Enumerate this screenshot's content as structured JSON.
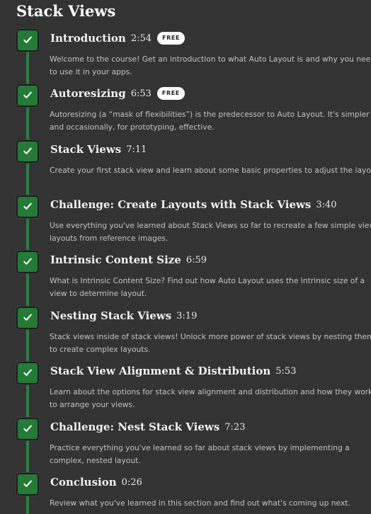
{
  "section": {
    "title": "Stack Views"
  },
  "colors": {
    "background": "#333333",
    "check_green": "#257a38",
    "timeline_green": "#2e7d42",
    "badge_bg": "#ffffff"
  },
  "lessons": [
    {
      "title": "Introduction",
      "duration": "2:54",
      "badge": "FREE",
      "completed": true,
      "description": "Welcome to the course! Get an introduction to what Auto Layout is and why you need to use it in your apps."
    },
    {
      "title": "Autoresizing",
      "duration": "6:53",
      "badge": "FREE",
      "completed": true,
      "description": "Autoresizing (a “mask of flexibilities”) is the predecessor to Auto Layout. It's simpler and occasionally, for prototyping, effective."
    },
    {
      "title": "Stack Views",
      "duration": "7:11",
      "completed": true,
      "description": "Create your first stack view and learn about some basic properties to adjust the layout."
    },
    {
      "title": "Challenge: Create Layouts with Stack Views",
      "duration": "3:40",
      "completed": true,
      "description": "Use everything you've learned about Stack Views so far to recreate a few simple view layouts from reference images."
    },
    {
      "title": "Intrinsic Content Size",
      "duration": "6:59",
      "completed": true,
      "description": "What is Intrinsic Content Size? Find out how Auto Layout uses the intrinsic size of a view to determine layout."
    },
    {
      "title": "Nesting Stack Views",
      "duration": "3:19",
      "completed": true,
      "description": "Stack views inside of stack views! Unlock more power of stack views by nesting them to create complex layouts."
    },
    {
      "title": "Stack View Alignment & Distribution",
      "duration": "5:53",
      "completed": true,
      "description": "Learn about the options for stack view alignment and distribution and how they work to arrange your views."
    },
    {
      "title": "Challenge: Nest Stack Views",
      "duration": "7:23",
      "completed": true,
      "description": "Practice everything you've learned so far about stack views by implementing a complex, nested layout."
    },
    {
      "title": "Conclusion",
      "duration": "0:26",
      "completed": true,
      "description": "Review what you've learned in this section and find out what's coming up next."
    }
  ]
}
